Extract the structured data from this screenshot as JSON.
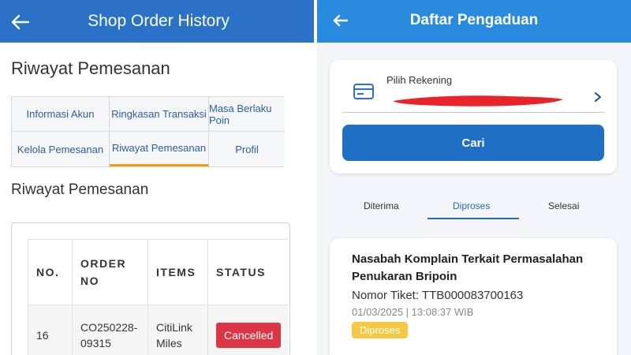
{
  "left": {
    "appbar": {
      "title": "Shop Order History"
    },
    "heading_main": "Riwayat Pemesanan",
    "tabs": [
      {
        "label": "Informasi Akun"
      },
      {
        "label": "Ringkasan Transaksi"
      },
      {
        "label": "Masa Berlaku Poin"
      },
      {
        "label": "Kelola Pemesanan"
      },
      {
        "label": "Riwayat Pemesanan"
      },
      {
        "label": "Profil"
      }
    ],
    "active_tab": "Riwayat Pemesanan",
    "heading_sub": "Riwayat Pemesanan",
    "table": {
      "headers": [
        "NO.",
        "ORDER NO",
        "ITEMS",
        "STATUS"
      ],
      "rows": [
        {
          "no": "16",
          "order_no": "CO250228-09315",
          "items": "CitiLink Miles",
          "status": "Cancelled"
        }
      ]
    },
    "colors": {
      "appbar": "#2a72c8",
      "active_underline": "#f39c12",
      "cancel_badge": "#dc3545"
    }
  },
  "right": {
    "appbar": {
      "title": "Daftar Pengaduan"
    },
    "account": {
      "label": "Pilih Rekening",
      "icon": "credit-card-icon"
    },
    "search_button": "Cari",
    "tabs": [
      {
        "label": "Diterima"
      },
      {
        "label": "Diproses"
      },
      {
        "label": "Selesai"
      }
    ],
    "active_tab": "Diproses",
    "complaint": {
      "title": "Nasabah Komplain Terkait Permasalahan Penukaran Bripoin",
      "ticket": "Nomor Tiket: TTB000083700163",
      "timestamp": "01/03/2025 | 13:08:37 WIB",
      "status": "Diproses"
    },
    "colors": {
      "appbar": "#2a8ae0",
      "button": "#1f6fc5",
      "status_badge": "#f5c842",
      "redaction": "#e8242a"
    }
  }
}
